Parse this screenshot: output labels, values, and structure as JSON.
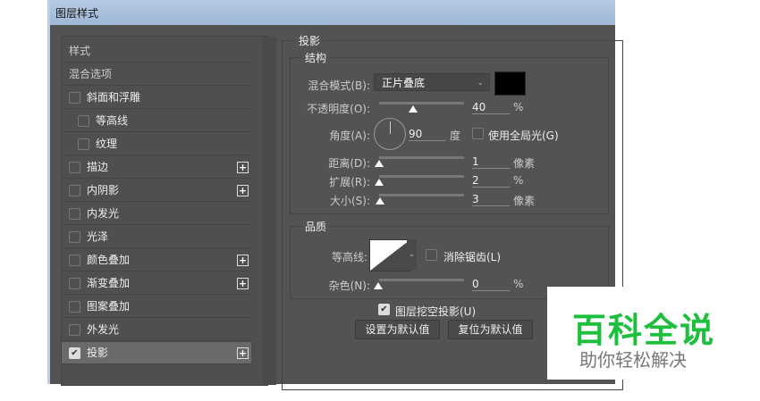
{
  "window": {
    "title": "图层样式"
  },
  "sidebar": {
    "items": [
      {
        "label": "样式",
        "type": "header"
      },
      {
        "label": "混合选项",
        "type": "header"
      },
      {
        "label": "斜面和浮雕",
        "checked": false,
        "indent": 0,
        "plus": false
      },
      {
        "label": "等高线",
        "checked": false,
        "indent": 1,
        "plus": false
      },
      {
        "label": "纹理",
        "checked": false,
        "indent": 1,
        "plus": false
      },
      {
        "label": "描边",
        "checked": false,
        "indent": 0,
        "plus": true
      },
      {
        "label": "内阴影",
        "checked": false,
        "indent": 0,
        "plus": true
      },
      {
        "label": "内发光",
        "checked": false,
        "indent": 0,
        "plus": false
      },
      {
        "label": "光泽",
        "checked": false,
        "indent": 0,
        "plus": false
      },
      {
        "label": "颜色叠加",
        "checked": false,
        "indent": 0,
        "plus": true
      },
      {
        "label": "渐变叠加",
        "checked": false,
        "indent": 0,
        "plus": true
      },
      {
        "label": "图案叠加",
        "checked": false,
        "indent": 0,
        "plus": false
      },
      {
        "label": "外发光",
        "checked": false,
        "indent": 0,
        "plus": false
      },
      {
        "label": "投影",
        "checked": true,
        "indent": 0,
        "plus": true,
        "selected": true
      }
    ]
  },
  "panel": {
    "title": "投影",
    "structure": {
      "title": "结构",
      "blend_label": "混合模式(B):",
      "blend_value": "正片叠底",
      "shadow_color": "#000000",
      "opacity_label": "不透明度(O):",
      "opacity": "40",
      "opacity_unit": "%",
      "angle_label": "角度(A):",
      "angle": "90",
      "angle_unit": "度",
      "global_light_label": "使用全局光(G)",
      "global_light": false,
      "distance_label": "距离(D):",
      "distance": "1",
      "distance_unit": "像素",
      "spread_label": "扩展(R):",
      "spread": "2",
      "spread_unit": "%",
      "size_label": "大小(S):",
      "size": "3",
      "size_unit": "像素"
    },
    "quality": {
      "title": "品质",
      "contour_label": "等高线:",
      "antialias_label": "消除锯齿(L)",
      "antialias": false,
      "noise_label": "杂色(N):",
      "noise": "0",
      "noise_unit": "%"
    },
    "knockout_label": "图层挖空投影(U)",
    "knockout": true,
    "set_default": "设置为默认值",
    "reset_default": "复位为默认值"
  },
  "watermark": {
    "brand": "百科全说",
    "slogan": "助你轻松解决"
  }
}
